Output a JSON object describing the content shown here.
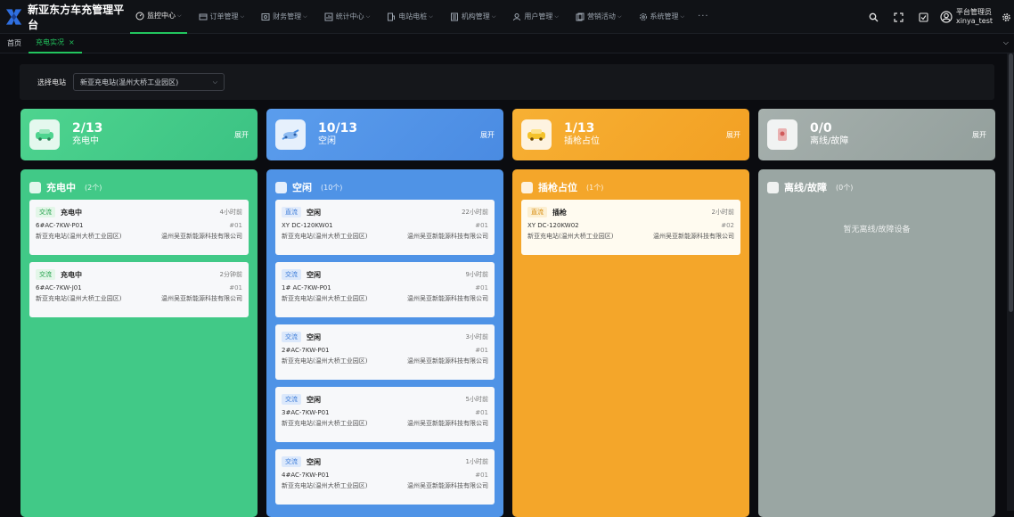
{
  "app": {
    "title": "新亚东方车充管理平台"
  },
  "menu": [
    {
      "label": "监控中心",
      "icon": "dashboard-icon",
      "active": true
    },
    {
      "label": "订单管理",
      "icon": "order-icon"
    },
    {
      "label": "财务管理",
      "icon": "finance-icon"
    },
    {
      "label": "统计中心",
      "icon": "stats-icon"
    },
    {
      "label": "电站电桩",
      "icon": "station-icon"
    },
    {
      "label": "机构管理",
      "icon": "org-icon"
    },
    {
      "label": "用户管理",
      "icon": "user-manage-icon"
    },
    {
      "label": "营销活动",
      "icon": "marketing-icon"
    },
    {
      "label": "系统管理",
      "icon": "system-icon"
    }
  ],
  "menu_more": "···",
  "user": {
    "role": "平台管理员",
    "name": "xinya_test"
  },
  "tabs": [
    {
      "label": "首页"
    },
    {
      "label": "充电实况",
      "active": true,
      "close": "×"
    }
  ],
  "filter": {
    "label": "选择电站",
    "value": "新亚充电站(温州大桥工业园区)"
  },
  "summary": [
    {
      "value": "2/13",
      "label": "充电中",
      "expand": "展开",
      "color": "#41c987"
    },
    {
      "value": "10/13",
      "label": "空闲",
      "expand": "展开",
      "color": "#4f93e6"
    },
    {
      "value": "1/13",
      "label": "插枪占位",
      "expand": "展开",
      "color": "#f4a62a"
    },
    {
      "value": "0/0",
      "label": "离线/故障",
      "expand": "展开",
      "color": "#9aa6a3"
    }
  ],
  "columns": [
    {
      "title": "充电中",
      "count": "(2个)",
      "color": "#41c987",
      "cards": [
        {
          "type": "交流",
          "status": "充电中",
          "time": "4小时前",
          "code": "6#AC-7KW-P01",
          "port": "#01",
          "station": "新亚充电站(温州大桥工业园区)",
          "company": "温州吴亚新能源科技有限公司"
        },
        {
          "type": "交流",
          "status": "充电中",
          "time": "2分钟前",
          "code": "6#AC-7KW-J01",
          "port": "#01",
          "station": "新亚充电站(温州大桥工业园区)",
          "company": "温州吴亚新能源科技有限公司"
        }
      ]
    },
    {
      "title": "空闲",
      "count": "(10个)",
      "color": "#4f93e6",
      "cards": [
        {
          "type": "直流",
          "status": "空闲",
          "time": "22小时前",
          "code": "XY DC-120KW01",
          "port": "#01",
          "station": "新亚充电站(温州大桥工业园区)",
          "company": "温州吴亚新能源科技有限公司"
        },
        {
          "type": "交流",
          "status": "空闲",
          "time": "9小时前",
          "code": "1# AC-7KW-P01",
          "port": "#01",
          "station": "新亚充电站(温州大桥工业园区)",
          "company": "温州吴亚新能源科技有限公司"
        },
        {
          "type": "交流",
          "status": "空闲",
          "time": "3小时前",
          "code": "2#AC-7KW-P01",
          "port": "#01",
          "station": "新亚充电站(温州大桥工业园区)",
          "company": "温州吴亚新能源科技有限公司"
        },
        {
          "type": "交流",
          "status": "空闲",
          "time": "5小时前",
          "code": "3#AC-7KW-P01",
          "port": "#01",
          "station": "新亚充电站(温州大桥工业园区)",
          "company": "温州吴亚新能源科技有限公司"
        },
        {
          "type": "交流",
          "status": "空闲",
          "time": "1小时前",
          "code": "4#AC-7KW-P01",
          "port": "#01",
          "station": "新亚充电站(温州大桥工业园区)",
          "company": "温州吴亚新能源科技有限公司"
        }
      ]
    },
    {
      "title": "插枪占位",
      "count": "(1个)",
      "color": "#f4a62a",
      "cards": [
        {
          "type": "直流",
          "status": "插枪",
          "time": "2小时前",
          "code": "XY DC-120KW02",
          "port": "#02",
          "station": "新亚充电站(温州大桥工业园区)",
          "company": "温州吴亚新能源科技有限公司"
        }
      ]
    },
    {
      "title": "离线/故障",
      "count": "(0个)",
      "color": "#9aa6a3",
      "empty": "暂无离线/故障设备",
      "cards": []
    }
  ]
}
